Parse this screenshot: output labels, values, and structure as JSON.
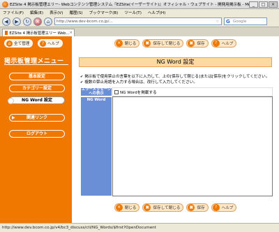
{
  "browser": {
    "window_title": "EZSite 4 掲示板管理エリー- Webコンテンツ管理システム『EZSite(イーザーサイト)』オフィシャル・ウェブサイト - 開発用掲示板 - Mozill...",
    "menu": [
      "ファイル(F)",
      "編集(E)",
      "表示(V)",
      "履歴(S)",
      "ブックマーク(B)",
      "ツール(T)",
      "ヘルプ(H)"
    ],
    "url": "http://www.dev-bcom.co.jp/...",
    "search_placeholder": "Google",
    "tab_title": "EZSite 4 掲示板管理エリー Web...",
    "status_url": "http://www.dev.bcom.co.jp/v4/bc3_discuss/ctl/NG_Words/$first?OpenDocument"
  },
  "header": {
    "all_admin": "全て管理",
    "help": "ヘルプ"
  },
  "sidebar": {
    "title": "掲示板管理メニュー",
    "items": [
      {
        "label": "基本設定"
      },
      {
        "label": "カテゴリー設定"
      },
      {
        "label": "NG Word 設定"
      },
      {
        "label": "関連リンク"
      },
      {
        "label": "ログアウト"
      }
    ]
  },
  "toolbar": {
    "close": "閉じる",
    "save_close": "保存して閉じる",
    "save": "保存",
    "help": "ヘルプ"
  },
  "main": {
    "title": "NG Word 設定",
    "notes": [
      "掲示板で使用禁止の言葉を以下に入力して、上の[保存して閉じる]または[保存]をクリックしてください。",
      "複数の禁止用語を入力する場合は、改行して入力してください。"
    ],
    "error_label": "エラーメッセージへの表示",
    "checkbox_label": "NG Wordを掲載する",
    "ngword_label": "NG Word",
    "ngword_value": ""
  }
}
